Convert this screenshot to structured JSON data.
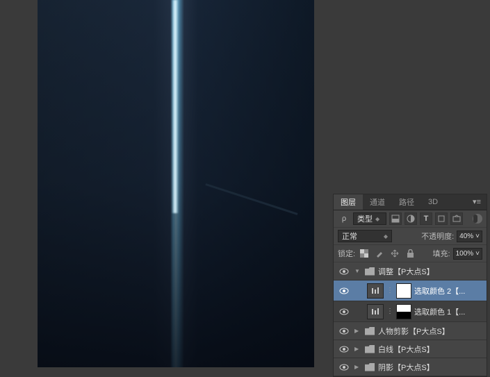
{
  "tabs": {
    "t1": "图层",
    "t2": "通道",
    "t3": "路径",
    "t4": "3D"
  },
  "filter": {
    "label": "类型"
  },
  "blend": {
    "mode": "正常",
    "opacity_label": "不透明度:",
    "opacity": "40%"
  },
  "lock": {
    "label": "锁定:",
    "fill_label": "填充:",
    "fill": "100%"
  },
  "layers": {
    "g0": "调整【P大点S】",
    "l1": "选取颜色 2【...",
    "l2": "选取颜色 1【...",
    "g1": "人物剪影【P大点S】",
    "g2": "白线【P大点S】",
    "g3": "阴影【P大点S】"
  }
}
